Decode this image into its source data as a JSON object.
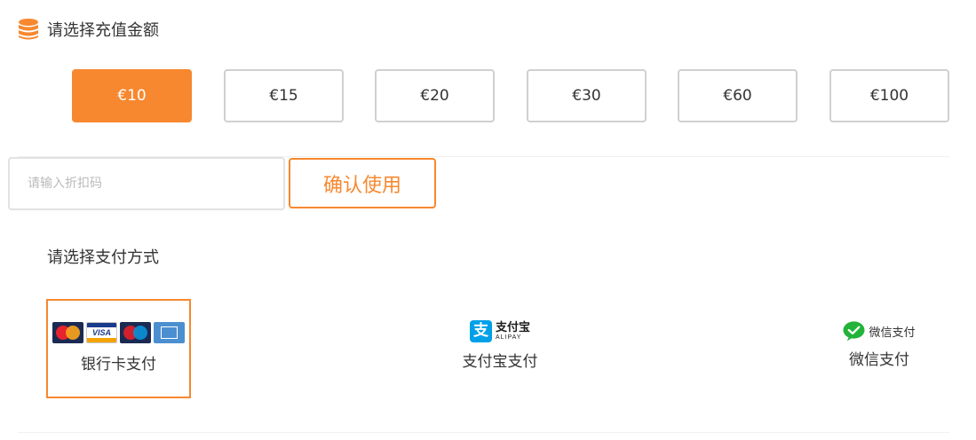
{
  "amount_section": {
    "title": "请选择充值金额",
    "icon": "coins-stack-icon",
    "accent_color": "#f7882f",
    "options": [
      "€10",
      "€15",
      "€20",
      "€30",
      "€60",
      "€100"
    ],
    "selected": "€10"
  },
  "coupon": {
    "placeholder": "请输入折扣码",
    "value": "",
    "confirm_label": "确认使用"
  },
  "payment_section": {
    "title": "请选择支付方式",
    "selected": "银行卡支付",
    "methods": [
      {
        "label": "银行卡支付",
        "icons": [
          "mastercard-icon",
          "visa-icon",
          "maestro-icon",
          "amex-icon"
        ]
      },
      {
        "label": "支付宝支付",
        "logo_cn": "支付宝",
        "logo_en": "ALIPAY",
        "logo_mark": "支",
        "icon": "alipay-icon"
      },
      {
        "label": "微信支付",
        "logo_text": "微信支付",
        "icon": "wechat-icon"
      }
    ]
  }
}
